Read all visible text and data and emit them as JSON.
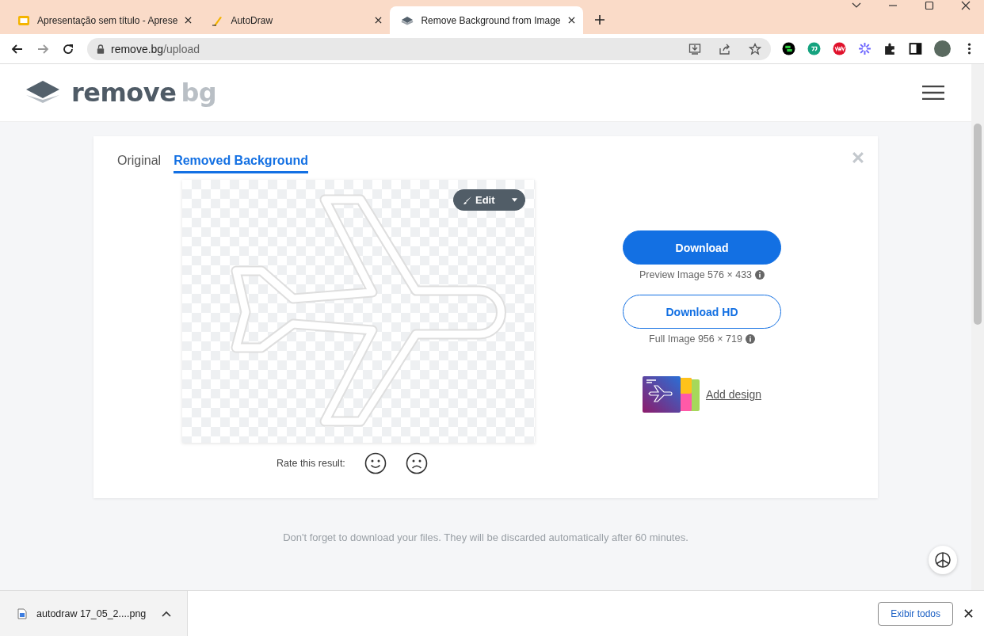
{
  "browser": {
    "tabs": [
      {
        "kind": "slides",
        "title": "Apresentação sem título - Aprese",
        "selected": false
      },
      {
        "kind": "autodraw",
        "title": "AutoDraw",
        "selected": false
      },
      {
        "kind": "removebg",
        "title": "Remove Background from Image",
        "selected": true
      }
    ],
    "address": {
      "domain": "remove.bg",
      "path": "/upload"
    }
  },
  "header": {
    "logo_primary": "remove",
    "logo_secondary": "bg"
  },
  "view_tabs": [
    {
      "label": "Original",
      "selected": false
    },
    {
      "label": "Removed Background",
      "selected": true
    }
  ],
  "edit_button": "Edit",
  "downloads": [
    {
      "kind": "primary",
      "label": "Download",
      "note": "Preview Image 576 × 433"
    },
    {
      "kind": "outline",
      "label": "Download HD",
      "note": "Full Image 956 × 719"
    }
  ],
  "add_design": "Add design",
  "rating_label": "Rate this result:",
  "footer_note": "Don't forget to download your files. They will be discarded automatically after 60 minutes.",
  "download_bar": {
    "file": "autodraw 17_05_2....png",
    "show_all": "Exibir todos"
  }
}
